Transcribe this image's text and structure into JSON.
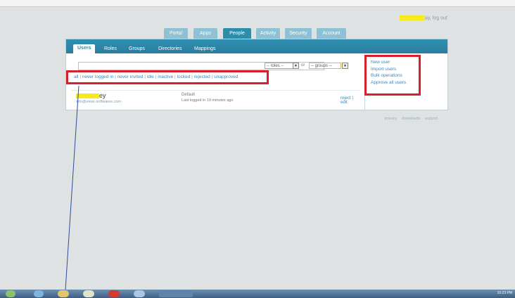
{
  "header": {
    "user_suffix": "ay,",
    "logout": "log out"
  },
  "main_tabs": [
    "Portal",
    "Apps",
    "People",
    "Activity",
    "Security",
    "Account"
  ],
  "sub_tabs": [
    "Users",
    "Roles",
    "Groups",
    "Directories",
    "Mappings"
  ],
  "search": {
    "value": "",
    "placeholder": ""
  },
  "roles_select": "-- roles --",
  "or_label": "or",
  "groups_select": "-- groups --",
  "filters": [
    "all",
    "never logged in",
    "never invited",
    "idle",
    "inactive",
    "locked",
    "rejected",
    "unapproved"
  ],
  "actions": [
    "New user",
    "Import users",
    "Bulk operations",
    "Approve all users"
  ],
  "user": {
    "name_suffix": "ey",
    "email": "info@elear-softwares.com",
    "group": "Default",
    "last_login": "Last logged in 19 minutes ago",
    "actions": "reject | edit"
  },
  "footer": [
    "privacy",
    "downloads",
    "support"
  ],
  "clock": "10:23 PM",
  "colors": {
    "accent": "#2e8cab",
    "tab_inactive": "#8fc1d4",
    "highlight_box": "#d8202c",
    "link": "#3f86b5",
    "redaction": "#f6ea1c"
  }
}
